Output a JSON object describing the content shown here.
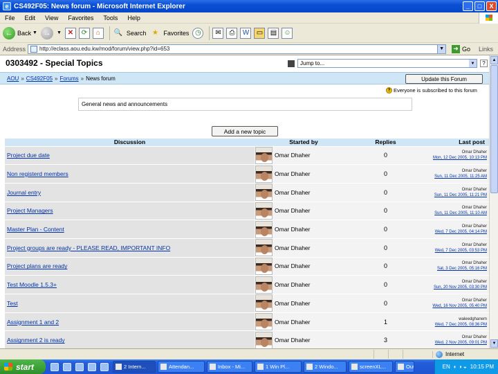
{
  "window": {
    "title": "CS492F05: News forum - Microsoft Internet Explorer",
    "buttons": [
      "_",
      "□",
      "X"
    ]
  },
  "menu": [
    "File",
    "Edit",
    "View",
    "Favorites",
    "Tools",
    "Help"
  ],
  "toolbar": {
    "back": "Back",
    "search": "Search",
    "favorites": "Favorites"
  },
  "address": {
    "label": "Address",
    "url": "http://eclass.aou.edu.kw/mod/forum/view.php?id=653",
    "go": "Go",
    "links": "Links"
  },
  "page": {
    "course_title": "0303492 - Special Topics",
    "jump_to": "Jump to...",
    "help": "?",
    "breadcrumb": [
      "AOU",
      "CS492F05",
      "Forums",
      "News forum"
    ],
    "breadcrumb_sep": "»",
    "update_button": "Update this Forum",
    "subscribed_note": "Everyone is subscribed to this forum",
    "intro": "General news and announcements",
    "add_topic_button": "Add a new topic",
    "columns": [
      "Discussion",
      "Started by",
      "Replies",
      "Last post"
    ],
    "rows": [
      {
        "topic": "Project due date",
        "author": "Omar Dhaher",
        "replies": "0",
        "last_name": "Omar Dhaher",
        "last_date": "Mon, 12 Dec 2005, 10:13 PM"
      },
      {
        "topic": "Non registerd members",
        "author": "Omar Dhaher",
        "replies": "0",
        "last_name": "Omar Dhaher",
        "last_date": "Sun, 11 Dec 2005, 11:25 AM"
      },
      {
        "topic": "Journal entry",
        "author": "Omar Dhaher",
        "replies": "0",
        "last_name": "Omar Dhaher",
        "last_date": "Sun, 11 Dec 2005, 11:21 PM"
      },
      {
        "topic": "Project Managers",
        "author": "Omar Dhaher",
        "replies": "0",
        "last_name": "Omar Dhaher",
        "last_date": "Sun, 11 Dec 2005, 11:10 AM"
      },
      {
        "topic": "Master Plan - Content",
        "author": "Omar Dhaher",
        "replies": "0",
        "last_name": "Omar Dhaher",
        "last_date": "Wed, 7 Dec 2005, 04:14 PM"
      },
      {
        "topic": "Project groups are ready - PLEASE READ, IMPORTANT INFO",
        "author": "Omar Dhaher",
        "replies": "0",
        "last_name": "Omar Dhaher",
        "last_date": "Wed, 7 Dec 2005, 03:53 PM"
      },
      {
        "topic": "Project plans are ready",
        "author": "Omar Dhaher",
        "replies": "0",
        "last_name": "Omar Dhaher",
        "last_date": "Sat, 3 Dec 2005, 05:16 PM"
      },
      {
        "topic": "Test Moodle 1.5.3+",
        "author": "Omar Dhaher",
        "replies": "0",
        "last_name": "Omar Dhaher",
        "last_date": "Sun, 20 Nov 2005, 03:30 PM"
      },
      {
        "topic": "Test",
        "author": "Omar Dhaher",
        "replies": "0",
        "last_name": "Omar Dhaher",
        "last_date": "Wed, 16 Nov 2005, 05:40 PM"
      },
      {
        "topic": "Assignment 1 and 2",
        "author": "Omar Dhaher",
        "replies": "1",
        "last_name": "waleedghanem",
        "last_date": "Wed, 7 Dec 2005, 08:36 PM"
      },
      {
        "topic": "Assignment 2 is ready",
        "author": "Omar Dhaher",
        "replies": "3",
        "last_name": "Omar Dhaher",
        "last_date": "Wed, 2 Nov 2005, 09:01 PM"
      }
    ]
  },
  "status": {
    "zone": "Internet"
  },
  "taskbar": {
    "start": "start",
    "tasks": [
      "2 Intern...",
      "Attendan...",
      "Inbox - Mi...",
      "1 Win Pl...",
      "2 Windo...",
      "screenXL...",
      "Outbox"
    ],
    "lang": "EN",
    "clock": "10:15 PM"
  },
  "colors": {
    "titlebar": "#0a4fd3",
    "table_header": "#cfe6f7",
    "link": "#0033aa"
  }
}
